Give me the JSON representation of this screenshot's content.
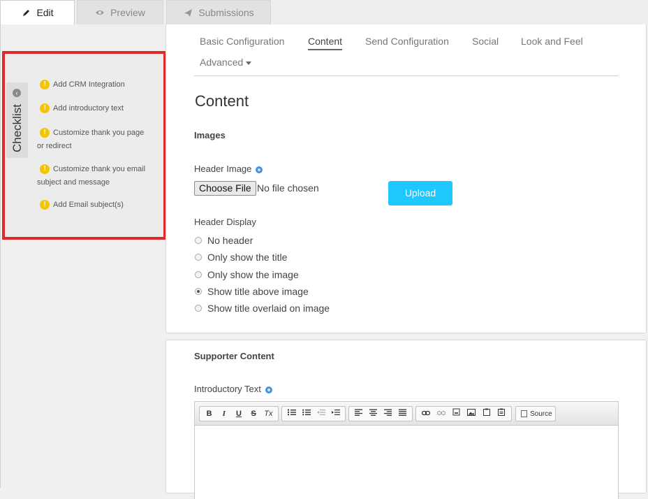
{
  "top_tabs": [
    {
      "label": "Edit",
      "icon": "pencil-icon",
      "active": true
    },
    {
      "label": "Preview",
      "icon": "eye-icon",
      "active": false
    },
    {
      "label": "Submissions",
      "icon": "paper-plane-icon",
      "active": false
    }
  ],
  "checklist": {
    "title": "Checklist",
    "items": [
      {
        "text": "Add CRM Integration"
      },
      {
        "text": "Add introductory text"
      },
      {
        "text": "Customize thank you page or redirect"
      },
      {
        "text": "Customize thank you email subject and message"
      },
      {
        "text": "Add Email subject(s)"
      }
    ],
    "warning_color": "#f5c400",
    "highlight_color": "#e02a2a"
  },
  "sub_tabs": [
    {
      "label": "Basic Configuration",
      "active": false
    },
    {
      "label": "Content",
      "active": true
    },
    {
      "label": "Send Configuration",
      "active": false
    },
    {
      "label": "Social",
      "active": false
    },
    {
      "label": "Look and Feel",
      "active": false
    },
    {
      "label": "Advanced",
      "active": false,
      "dropdown": true
    }
  ],
  "content": {
    "heading": "Content",
    "images_heading": "Images",
    "header_image_label": "Header Image",
    "choose_file_label": "Choose File",
    "no_file_text": "No file chosen",
    "upload_label": "Upload",
    "upload_color": "#1ec8ff",
    "header_display_label": "Header Display",
    "header_display_options": [
      {
        "label": "No header",
        "checked": false
      },
      {
        "label": "Only show the title",
        "checked": false
      },
      {
        "label": "Only show the image",
        "checked": false
      },
      {
        "label": "Show title above image",
        "checked": true
      },
      {
        "label": "Show title overlaid on image",
        "checked": false
      }
    ]
  },
  "supporter": {
    "heading": "Supporter Content",
    "intro_label": "Introductory Text",
    "toolbar": {
      "bold": "B",
      "italic": "I",
      "underline": "U",
      "strike": "S",
      "clear_format": "Tx",
      "source_label": "Source"
    }
  }
}
